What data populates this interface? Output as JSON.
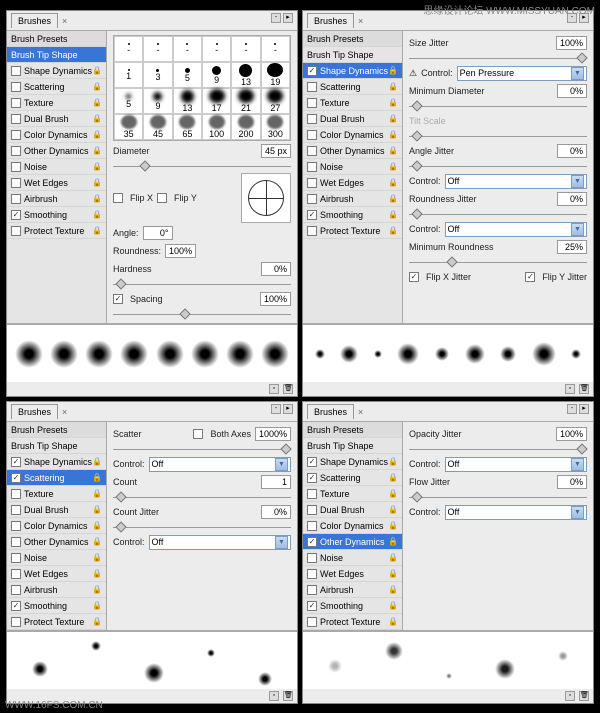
{
  "watermarks": {
    "top": "思缘设计论坛 WWW.MISSYUAN.COM",
    "bottom": "WWW.16FS.COM.CN"
  },
  "tabName": "Brushes",
  "presets": [
    {
      "id": "presets",
      "label": "Brush Presets",
      "type": "header"
    },
    {
      "id": "tip",
      "label": "Brush Tip Shape",
      "type": "plain"
    },
    {
      "id": "shape",
      "label": "Shape Dynamics",
      "type": "check"
    },
    {
      "id": "scatter",
      "label": "Scattering",
      "type": "check"
    },
    {
      "id": "texture",
      "label": "Texture",
      "type": "check"
    },
    {
      "id": "dual",
      "label": "Dual Brush",
      "type": "check"
    },
    {
      "id": "color",
      "label": "Color Dynamics",
      "type": "check"
    },
    {
      "id": "other",
      "label": "Other Dynamics",
      "type": "check"
    },
    {
      "id": "noise",
      "label": "Noise",
      "type": "check"
    },
    {
      "id": "wet",
      "label": "Wet Edges",
      "type": "check"
    },
    {
      "id": "air",
      "label": "Airbrush",
      "type": "check"
    },
    {
      "id": "smooth",
      "label": "Smoothing",
      "type": "check"
    },
    {
      "id": "protect",
      "label": "Protect Texture",
      "type": "check"
    }
  ],
  "panel1": {
    "selected": "tip",
    "checked": [
      "smooth"
    ],
    "brushSizes": [
      "-",
      "-",
      "-",
      "-",
      "-",
      "-",
      "1",
      "3",
      "5",
      "9",
      "13",
      "19",
      "5",
      "9",
      "13",
      "17",
      "21",
      "27",
      "35",
      "45",
      "65",
      "100",
      "200",
      "300"
    ],
    "diameter": {
      "label": "Diameter",
      "value": "45 px"
    },
    "flipX": "Flip X",
    "flipY": "Flip Y",
    "angle": {
      "label": "Angle:",
      "value": "0°"
    },
    "roundness": {
      "label": "Roundness:",
      "value": "100%"
    },
    "hardness": {
      "label": "Hardness",
      "value": "0%"
    },
    "spacing": {
      "label": "Spacing",
      "value": "100%"
    }
  },
  "panel2": {
    "selected": "shape",
    "checked": [
      "shape",
      "smooth"
    ],
    "sizeJitter": {
      "label": "Size Jitter",
      "value": "100%"
    },
    "control": {
      "label": "Control:",
      "value": "Pen Pressure"
    },
    "minDiam": {
      "label": "Minimum Diameter",
      "value": "0%"
    },
    "tiltScale": "Tilt Scale",
    "angleJitter": {
      "label": "Angle Jitter",
      "value": "0%"
    },
    "control2": {
      "label": "Control:",
      "value": "Off"
    },
    "roundJitter": {
      "label": "Roundness Jitter",
      "value": "0%"
    },
    "control3": {
      "label": "Control:",
      "value": "Off"
    },
    "minRound": {
      "label": "Minimum Roundness",
      "value": "25%"
    },
    "flipXJ": "Flip X Jitter",
    "flipYJ": "Flip Y Jitter"
  },
  "panel3": {
    "selected": "scatter",
    "checked": [
      "shape",
      "scatter",
      "smooth"
    ],
    "scatter": {
      "label": "Scatter",
      "both": "Both Axes",
      "value": "1000%"
    },
    "control": {
      "label": "Control:",
      "value": "Off"
    },
    "count": {
      "label": "Count",
      "value": "1"
    },
    "countJitter": {
      "label": "Count Jitter",
      "value": "0%"
    },
    "control2": {
      "label": "Control:",
      "value": "Off"
    }
  },
  "panel4": {
    "selected": "other",
    "checked": [
      "shape",
      "scatter",
      "other",
      "smooth"
    ],
    "opacityJitter": {
      "label": "Opacity Jitter",
      "value": "100%"
    },
    "control": {
      "label": "Control:",
      "value": "Off"
    },
    "flowJitter": {
      "label": "Flow Jitter",
      "value": "0%"
    },
    "control2": {
      "label": "Control:",
      "value": "Off"
    }
  }
}
